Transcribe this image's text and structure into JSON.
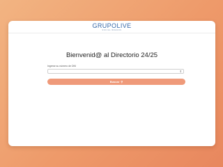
{
  "brand": {
    "name": "GRUPOLIVE",
    "tagline": "SOCIAL BRANDS"
  },
  "main": {
    "title": "Bienvenid@ al Directorio 24/25",
    "select_label": "Ingrese su número de DNI",
    "select_value": "",
    "submit_label": "Buscar",
    "submit_icon": "search-icon"
  },
  "colors": {
    "accent": "#ef9a7a",
    "brand": "#3467a8"
  }
}
